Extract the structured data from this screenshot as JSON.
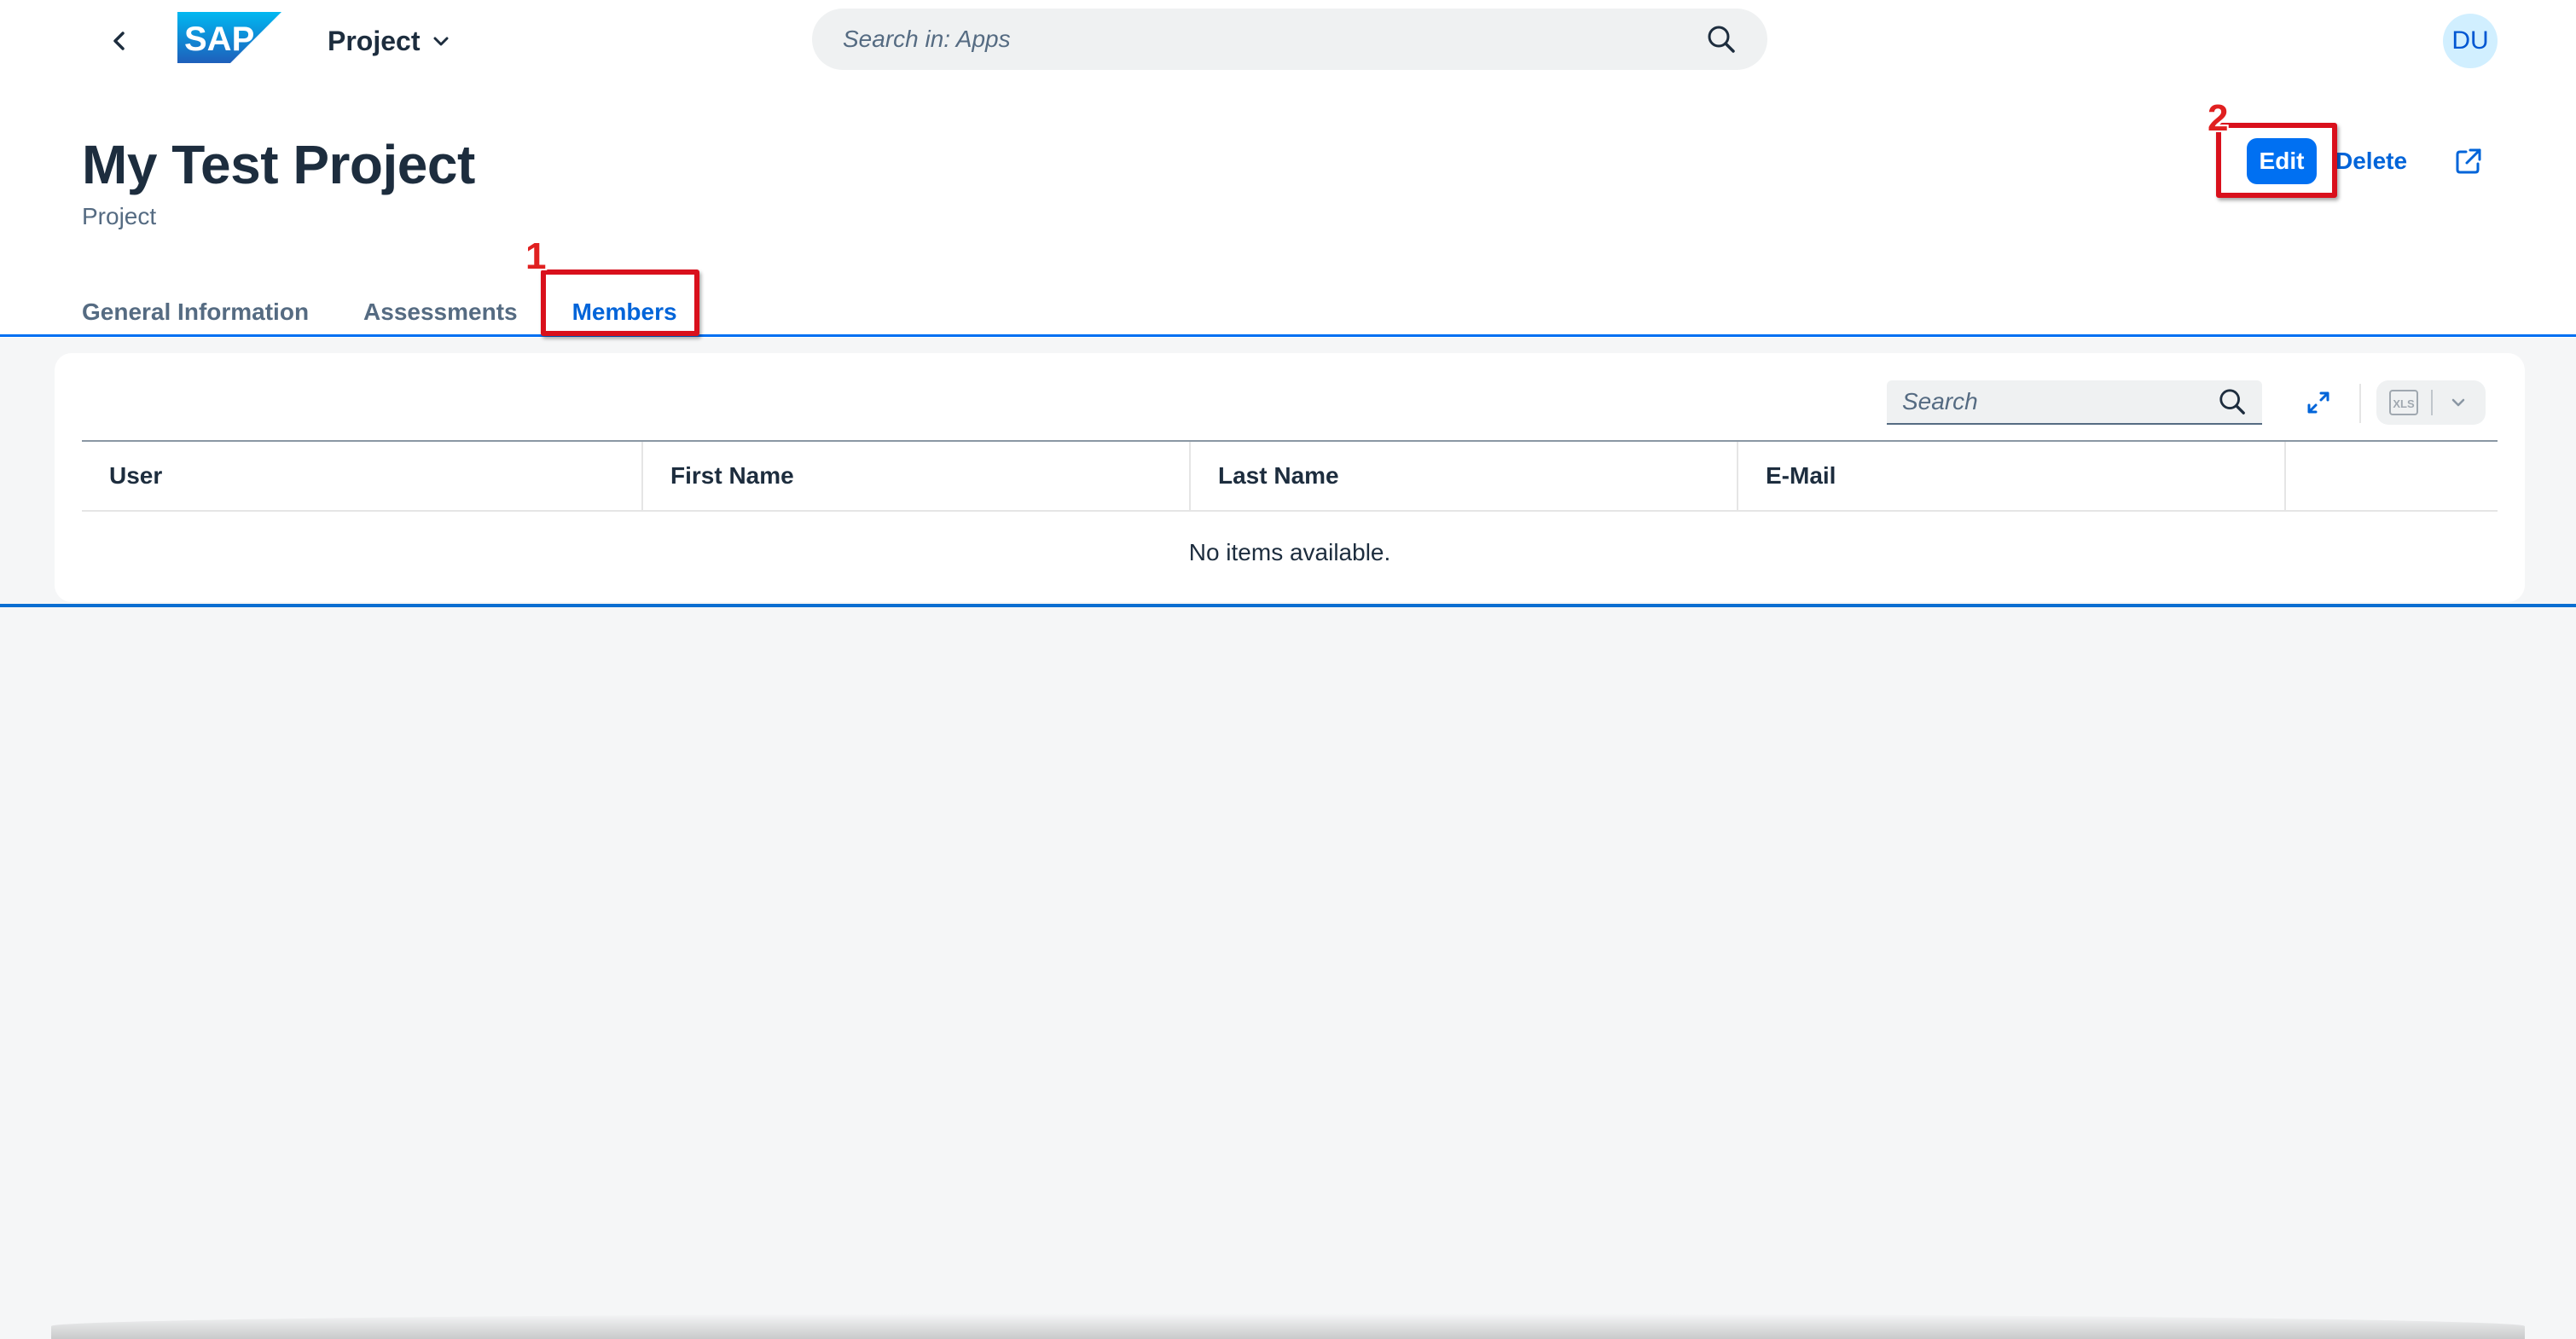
{
  "shell": {
    "app_title": "Project",
    "search_placeholder": "Search in: Apps",
    "avatar_initials": "DU",
    "logo_text": "SAP"
  },
  "header": {
    "title": "My Test Project",
    "subtitle": "Project",
    "edit_label": "Edit",
    "delete_label": "Delete"
  },
  "tabs": [
    {
      "label": "General Information",
      "active": false
    },
    {
      "label": "Assessments",
      "active": false
    },
    {
      "label": "Members",
      "active": true
    }
  ],
  "annotations": {
    "step1": "1",
    "step2": "2"
  },
  "table": {
    "search_placeholder": "Search",
    "export_label": "XLS",
    "columns": [
      "User",
      "First Name",
      "Last Name",
      "E-Mail"
    ],
    "empty_text": "No items available."
  },
  "colors": {
    "brand_blue": "#0070f2",
    "annotation_red": "#d9101c"
  }
}
